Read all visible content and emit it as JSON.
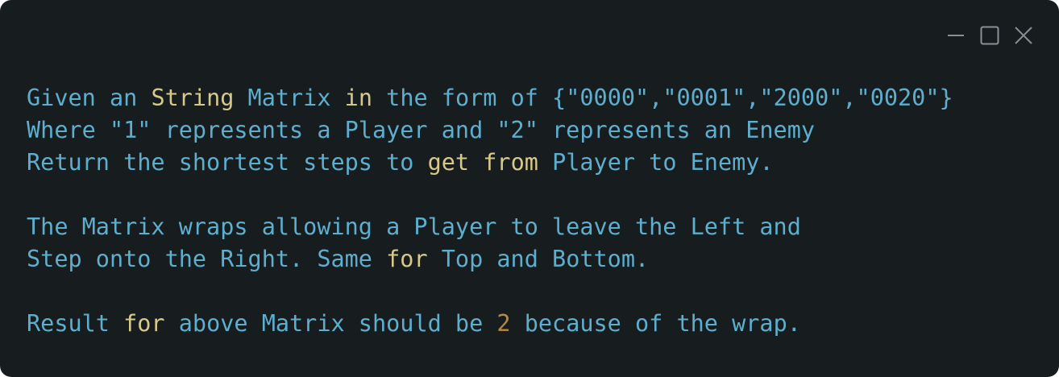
{
  "window": {
    "controls": {
      "minimize_icon": "minimize-icon",
      "maximize_icon": "maximize-icon",
      "close_icon": "close-icon"
    }
  },
  "colors": {
    "background": "#171c1f",
    "text": "#5eaecd",
    "keyword": "#d7c98b",
    "number": "#b58a47",
    "controls": "#8a8f93"
  },
  "content": {
    "lines": [
      [
        {
          "t": "Given an ",
          "c": "text"
        },
        {
          "t": "String",
          "c": "kw"
        },
        {
          "t": " Matrix ",
          "c": "text"
        },
        {
          "t": "in",
          "c": "kw"
        },
        {
          "t": " the form of {\"0000\",\"0001\",\"2000\",\"0020\"}",
          "c": "text"
        }
      ],
      [
        {
          "t": "Where \"1\" represents a Player and \"2\" represents an Enemy",
          "c": "text"
        }
      ],
      [
        {
          "t": "Return the shortest steps to ",
          "c": "text"
        },
        {
          "t": "get",
          "c": "kw"
        },
        {
          "t": " ",
          "c": "text"
        },
        {
          "t": "from",
          "c": "kw"
        },
        {
          "t": " Player to Enemy.",
          "c": "text"
        }
      ],
      [],
      [
        {
          "t": "The Matrix wraps allowing a Player to leave the Left and",
          "c": "text"
        }
      ],
      [
        {
          "t": "Step onto the Right. Same ",
          "c": "text"
        },
        {
          "t": "for",
          "c": "kw"
        },
        {
          "t": " Top and Bottom.",
          "c": "text"
        }
      ],
      [],
      [
        {
          "t": "Result ",
          "c": "text"
        },
        {
          "t": "for",
          "c": "kw"
        },
        {
          "t": " above Matrix should be ",
          "c": "text"
        },
        {
          "t": "2",
          "c": "num"
        },
        {
          "t": " because of the wrap.",
          "c": "text"
        }
      ]
    ]
  }
}
